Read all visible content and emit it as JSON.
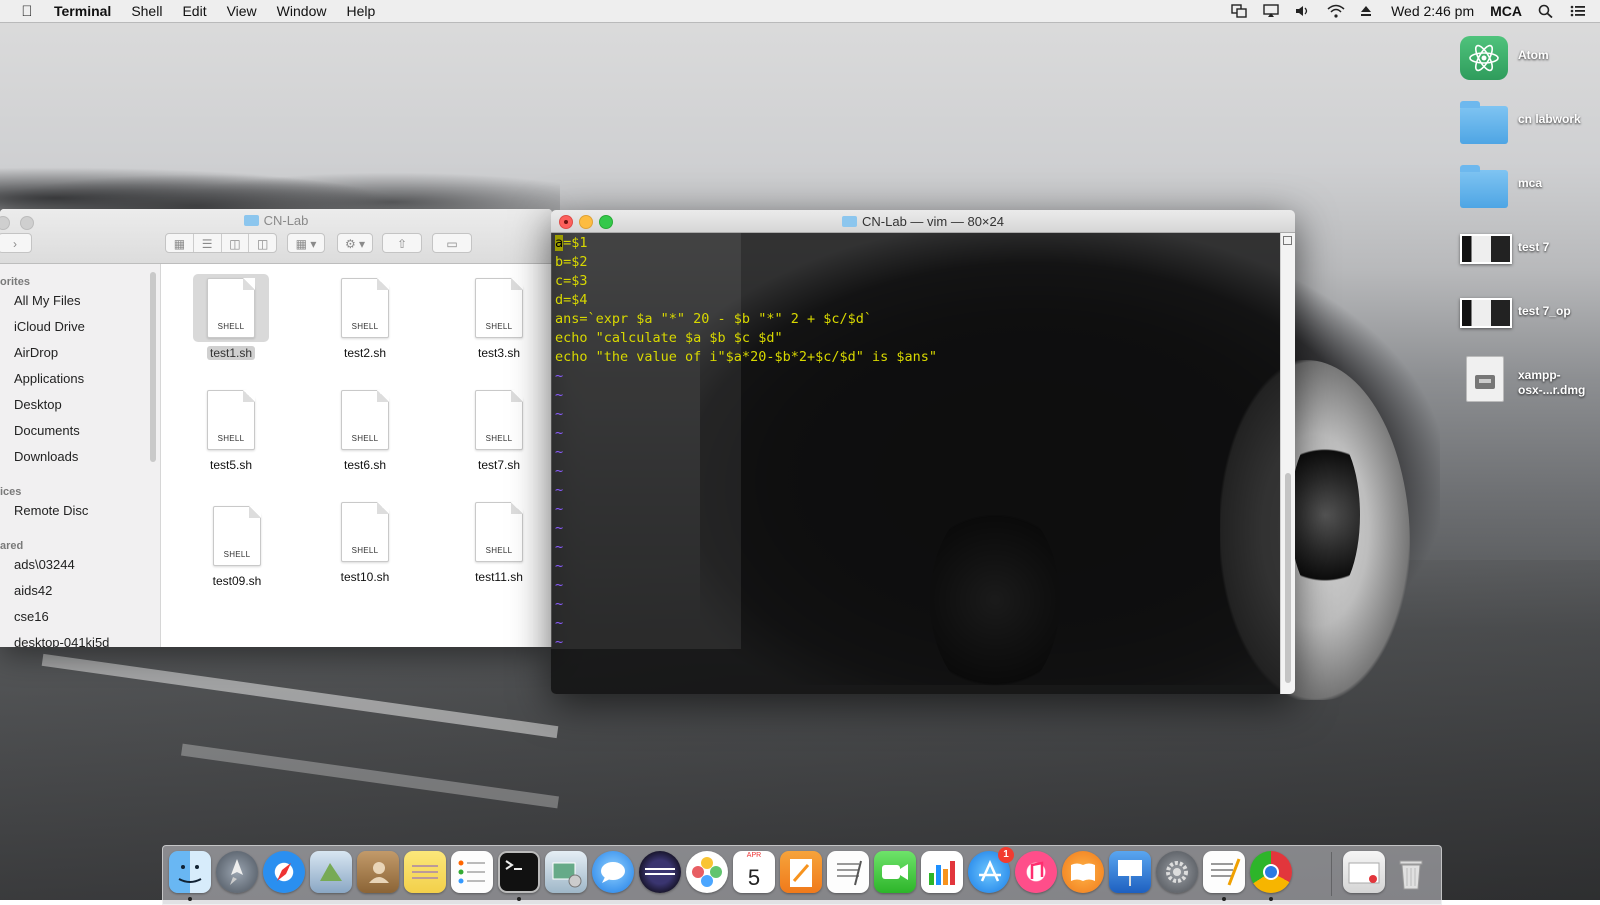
{
  "menubar": {
    "app_name": "Terminal",
    "menus": [
      "Shell",
      "Edit",
      "View",
      "Window",
      "Help"
    ],
    "clock": "Wed 2:46 pm",
    "user": "MCA"
  },
  "finder": {
    "title": "CN-Lab",
    "sidebar": {
      "favorites_header": "orites",
      "favorites": [
        "All My Files",
        "iCloud Drive",
        "AirDrop",
        "Applications",
        "Desktop",
        "Documents",
        "Downloads"
      ],
      "devices_header": "ices",
      "devices": [
        "Remote Disc"
      ],
      "shared_header": "ared",
      "shared": [
        "ads\\03244",
        "aids42",
        "cse16",
        "desktop-041ki5d"
      ]
    },
    "files": [
      {
        "name": "test1.sh",
        "kind": "SHELL",
        "selected": true
      },
      {
        "name": "test2.sh",
        "kind": "SHELL"
      },
      {
        "name": "test3.sh",
        "kind": "SHELL"
      },
      {
        "name": "test5.sh",
        "kind": "SHELL"
      },
      {
        "name": "test6.sh",
        "kind": "SHELL"
      },
      {
        "name": "test7.sh",
        "kind": "SHELL"
      },
      {
        "name": "test09.sh",
        "kind": "SHELL"
      },
      {
        "name": "test10.sh",
        "kind": "SHELL"
      },
      {
        "name": "test11.sh",
        "kind": "SHELL"
      }
    ]
  },
  "terminal": {
    "title": "CN-Lab — vim — 80×24",
    "cursor_char": "a",
    "first_line_rest": "=$1",
    "lines": [
      "b=$2",
      "c=$3",
      "d=$4",
      "ans=`expr $a \"*\" 20 - $b \"*\" 2 + $c/$d`",
      "echo \"calculate $a $b $c $d\"",
      "echo \"the value of i\"$a*20-$b*2+$c/$d\" is $ans\""
    ],
    "tilde": "~"
  },
  "desktop_icons": [
    {
      "label": "Atom",
      "type": "app"
    },
    {
      "label": "cn labwork",
      "type": "folder"
    },
    {
      "label": "mca",
      "type": "folder"
    },
    {
      "label": "test 7",
      "type": "image"
    },
    {
      "label": "test 7_op",
      "type": "image"
    },
    {
      "label_line1": "xampp-",
      "label_line2": "osx-...r.dmg",
      "type": "dmg"
    }
  ],
  "dock": {
    "calendar_month": "APR",
    "calendar_day": "5",
    "appstore_badge": "1",
    "apps": [
      "Finder",
      "Launchpad",
      "Safari",
      "Preview",
      "Contacts",
      "Notes",
      "Reminders",
      "Terminal",
      "Image Capture",
      "Messages",
      "Eclipse",
      "Photos",
      "Calendar",
      "Pages",
      "TextEdit",
      "FaceTime",
      "Numbers",
      "App Store",
      "iTunes",
      "iBooks",
      "Keynote",
      "System Preferences",
      "TextEdit",
      "Google Chrome",
      "Downloads",
      "Trash"
    ]
  }
}
